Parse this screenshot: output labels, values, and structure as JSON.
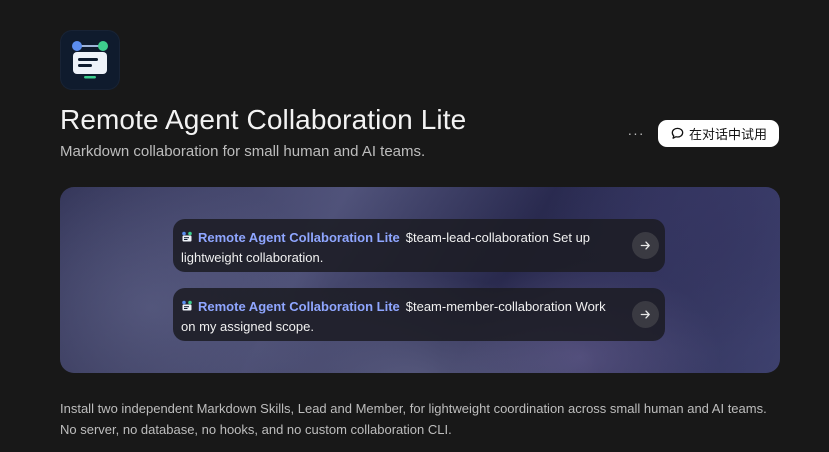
{
  "app": {
    "icon": "agent-collaboration-logo-icon",
    "title": "Remote Agent Collaboration Lite",
    "subtitle": "Markdown collaboration for small human and AI teams."
  },
  "actions": {
    "more_label": "···",
    "try_in_chat_label": "在对话中试用",
    "try_in_chat_icon": "chat-bubble-icon"
  },
  "prompts": [
    {
      "app_name": "Remote Agent Collaboration Lite",
      "text": "$team-lead-collaboration Set up lightweight collaboration."
    },
    {
      "app_name": "Remote Agent Collaboration Lite",
      "text": "$team-member-collaboration Work on my assigned scope."
    }
  ],
  "description": {
    "line1": "Install two independent Markdown Skills, Lead and Member, for lightweight coordination across small human and AI teams.",
    "line2": "No server, no database, no hooks, and no custom collaboration CLI."
  },
  "colors": {
    "background": "#181818",
    "accent_link": "#8fa6ff",
    "button_bg": "#ffffff",
    "icon_blue": "#5b8def",
    "icon_green": "#3ecf8e"
  }
}
